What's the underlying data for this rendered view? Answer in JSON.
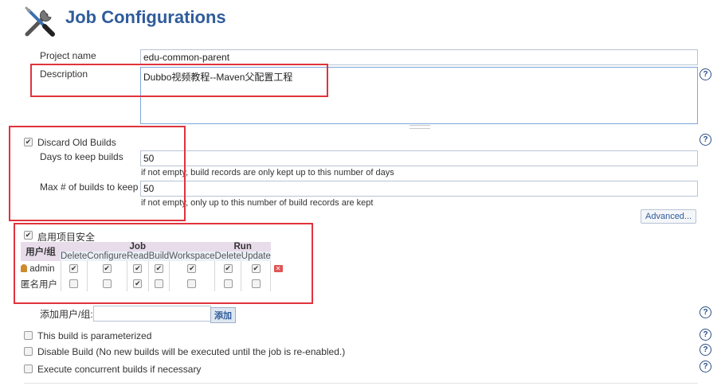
{
  "header": {
    "title": "Job Configurations",
    "icon": "wrench-screwdriver-icon"
  },
  "project_name": {
    "label": "Project name",
    "value": "edu-common-parent"
  },
  "description": {
    "label": "Description",
    "value": "Dubbo视频教程--Maven父配置工程"
  },
  "discard_old_builds": {
    "label": "Discard Old Builds",
    "checked": true,
    "days_label": "Days to keep builds",
    "days_value": "50",
    "days_hint": "if not empty, build records are only kept up to this number of days",
    "max_label": "Max # of builds to keep",
    "max_value": "50",
    "max_hint": "if not empty, only up to this number of build records are kept",
    "advanced_label": "Advanced..."
  },
  "security": {
    "label": "启用项目安全",
    "checked": true,
    "user_group_header": "用户/组",
    "group_job": "Job",
    "group_run": "Run",
    "columns": [
      "Delete",
      "Configure",
      "Read",
      "Build",
      "Workspace",
      "Delete",
      "Update"
    ],
    "rows": [
      {
        "name": "admin",
        "perms": [
          true,
          true,
          true,
          true,
          true,
          true,
          true
        ]
      },
      {
        "name": "匿名用户",
        "perms": [
          false,
          false,
          true,
          false,
          false,
          false,
          false
        ]
      }
    ],
    "add_label": "添加用户/组:",
    "add_button": "添加"
  },
  "options": [
    {
      "label": "This build is parameterized",
      "checked": false
    },
    {
      "label": "Disable Build (No new builds will be executed until the job is re-enabled.)",
      "checked": false
    },
    {
      "label": "Execute concurrent builds if necessary",
      "checked": false
    }
  ],
  "colors": {
    "title": "#2f5c9b",
    "highlight": "#e0333c",
    "perm_header": "#e8dceb"
  }
}
